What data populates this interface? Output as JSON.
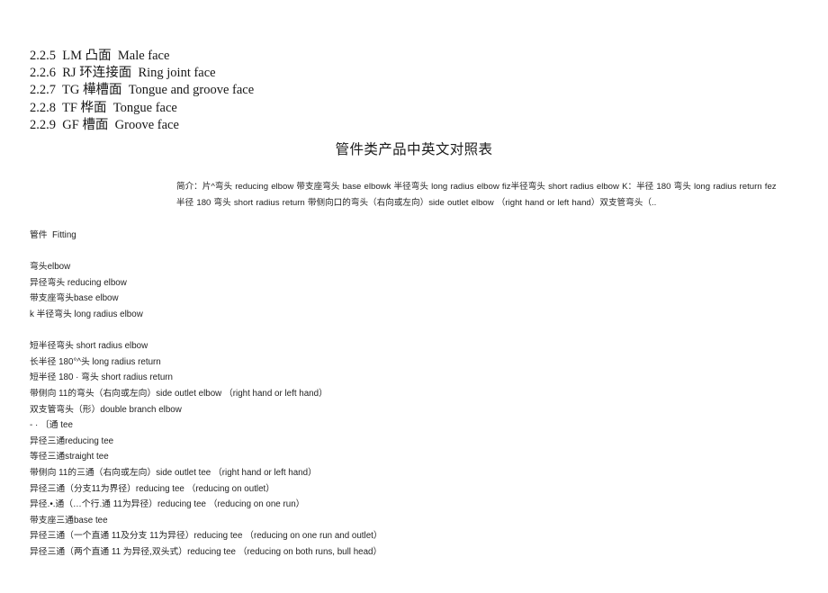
{
  "document": {
    "background_color": "#ffffff",
    "text_color": "#1f1f1f",
    "title": "管件类产品中英文对照表"
  },
  "numbered_list": {
    "items": [
      "2.2.5  LM 凸面  Male face",
      "2.2.6  RJ 环连接面  Ring joint face",
      "2.2.7  TG 樺槽面  Tongue and groove face",
      "2.2.8  TF 桦面  Tongue face",
      "2.2.9  GF 槽面  Groove face"
    ]
  },
  "intro": {
    "text": "简介：片^弯头 reducing elbow 带支座弯头 base elbowk 半径弯头 long radius elbow fiz半径弯头 short radius elbow K：半径 180 弯头 long radius return fez半径 180 弯头 short radius return 带侧向口的弯头（右向或左向）side outlet elbow （right hand or left hand）双支管弯头（.."
  },
  "glossary": {
    "header": "管件  Fitting",
    "groups": [
      {
        "name": "elbow-group-1",
        "lines": [
          "弯头elbow",
          "异径弯头 reducing elbow",
          "带支座弯头base elbow",
          "k 半径弯头 long radius elbow"
        ]
      },
      {
        "name": "elbow-group-2",
        "lines": [
          "短半径弯头 short radius elbow",
          "长半径 180°^头 long radius return",
          "短半径 180 · 弯头 short radius return",
          "带侧向 11的弯头（右向或左向）side outlet elbow （right hand or left hand）",
          "双支管弯头（形）double branch elbow",
          "- · 〔通 tee",
          "异径三通reducing tee",
          "等径三通straight tee",
          "带侧向 11的三通（右向或左向）side outlet tee （right hand or left hand）",
          "异径三通（分支11为界径）reducing tee （reducing on outlet）",
          "异径.•.通（…个行.通 11为异径）reducing tee （reducing on one run）",
          "带支座三通base tee",
          "异径三通（一个直通 11及分支 11为异径）reducing tee （reducing on one run and outlet）",
          "异径三通（两个直通 11 为异径,双头式）reducing tee （reducing on both runs, bull head）"
        ]
      }
    ]
  }
}
